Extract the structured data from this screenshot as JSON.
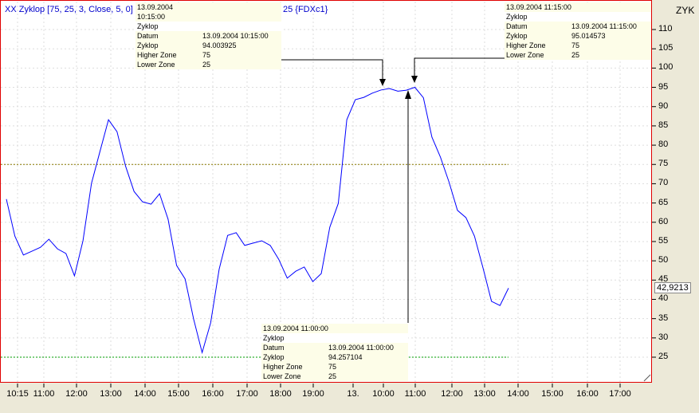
{
  "chart_data": {
    "type": "line",
    "title": "XX Zyklop [75, 25, 3, Close, 5, 0] 4",
    "title_suffix": "25 {FDXc1}",
    "ylabel": "ZYK",
    "ylim": [
      20,
      115
    ],
    "yticks": [
      25,
      30,
      35,
      40,
      45,
      50,
      55,
      60,
      65,
      70,
      75,
      80,
      85,
      90,
      95,
      100,
      105,
      110
    ],
    "xtick_labels": [
      "10:15",
      "11:00",
      "12:00",
      "13:00",
      "14:00",
      "15:00",
      "16:00",
      "17:00",
      "18:00",
      "19:00",
      "13.",
      "10:00",
      "11:00",
      "12:00",
      "13:00",
      "14:00",
      "15:00",
      "16:00",
      "17:00"
    ],
    "series": [
      {
        "name": "Zyklop",
        "color": "#0000ff",
        "values": [
          66,
          56.4,
          51.5,
          52.5,
          53.5,
          55.6,
          53.1,
          51.9,
          46.1,
          55.2,
          70.1,
          78.4,
          86.6,
          83.5,
          74.6,
          68,
          65.3,
          64.7,
          67.4,
          60.8,
          48.8,
          45.3,
          34.9,
          26.2,
          33.9,
          47.8,
          56.6,
          57.3,
          54,
          54.6,
          55.2,
          54,
          50.4,
          45.5,
          47.3,
          48.4,
          44.6,
          46.7,
          58.7,
          64.9,
          86.6,
          91.8,
          92.4,
          93.5,
          94.3,
          94.7,
          94.0,
          94.26,
          95.01,
          92.3,
          82.1,
          76.9,
          70.5,
          63.1,
          61.2,
          56.4,
          48.2,
          39.5,
          38.4,
          42.92
        ]
      }
    ],
    "higher_zone": 75,
    "lower_zone": 25,
    "last_value": "42,9213",
    "tooltips": [
      {
        "header": "13.09.2004 10:15:00",
        "name": "Zyklop",
        "rows": [
          [
            "Datum",
            "13.09.2004 10:15:00"
          ],
          [
            "Zyklop",
            "94.003925"
          ],
          [
            "Higher Zone",
            "75"
          ],
          [
            "Lower Zone",
            "25"
          ]
        ]
      },
      {
        "header": "13.09.2004 11:15:00",
        "name": "Zyklop",
        "rows": [
          [
            "Datum",
            "13.09.2004 11:15:00"
          ],
          [
            "Zyklop",
            "95.014573"
          ],
          [
            "Higher Zone",
            "75"
          ],
          [
            "Lower Zone",
            "25"
          ]
        ]
      },
      {
        "header": "13.09.2004 11:00:00",
        "name": "Zyklop",
        "rows": [
          [
            "Datum",
            "13.09.2004 11:00:00"
          ],
          [
            "Zyklop",
            "94.257104"
          ],
          [
            "Higher Zone",
            "75"
          ],
          [
            "Lower Zone",
            "25"
          ]
        ]
      }
    ]
  }
}
